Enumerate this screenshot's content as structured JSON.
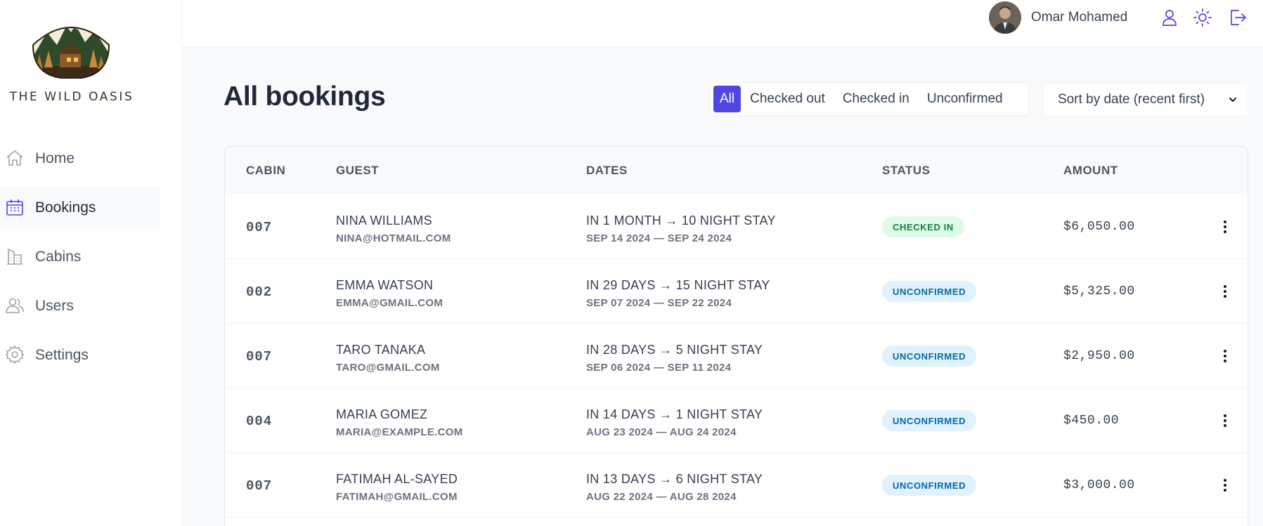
{
  "brand": {
    "name": "THE WILD OASIS"
  },
  "nav": [
    {
      "label": "Home",
      "icon": "home-icon",
      "active": false
    },
    {
      "label": "Bookings",
      "icon": "calendar-icon",
      "active": true
    },
    {
      "label": "Cabins",
      "icon": "building-icon",
      "active": false
    },
    {
      "label": "Users",
      "icon": "users-icon",
      "active": false
    },
    {
      "label": "Settings",
      "icon": "gear-icon",
      "active": false
    }
  ],
  "header": {
    "user_name": "Omar Mohamed",
    "icons": [
      "user-icon",
      "sun-icon",
      "logout-icon"
    ]
  },
  "page": {
    "title": "All bookings"
  },
  "filter": {
    "options": [
      "All",
      "Checked out",
      "Checked in",
      "Unconfirmed"
    ],
    "active": "All"
  },
  "sort": {
    "selected": "Sort by date (recent first)"
  },
  "table": {
    "headers": [
      "CABIN",
      "GUEST",
      "DATES",
      "STATUS",
      "AMOUNT"
    ],
    "rows": [
      {
        "cabin": "007",
        "guest": "NINA WILLIAMS",
        "email": "NINA@HOTMAIL.COM",
        "when": "IN 1 MONTH → 10 NIGHT STAY",
        "range": "SEP 14 2024 — SEP 24 2024",
        "status": "CHECKED IN",
        "status_type": "checked-in",
        "amount": "$6,050.00"
      },
      {
        "cabin": "002",
        "guest": "EMMA WATSON",
        "email": "EMMA@GMAIL.COM",
        "when": "IN 29 DAYS → 15 NIGHT STAY",
        "range": "SEP 07 2024 — SEP 22 2024",
        "status": "UNCONFIRMED",
        "status_type": "unconfirmed",
        "amount": "$5,325.00"
      },
      {
        "cabin": "007",
        "guest": "TARO TANAKA",
        "email": "TARO@GMAIL.COM",
        "when": "IN 28 DAYS → 5 NIGHT STAY",
        "range": "SEP 06 2024 — SEP 11 2024",
        "status": "UNCONFIRMED",
        "status_type": "unconfirmed",
        "amount": "$2,950.00"
      },
      {
        "cabin": "004",
        "guest": "MARIA GOMEZ",
        "email": "MARIA@EXAMPLE.COM",
        "when": "IN 14 DAYS → 1 NIGHT STAY",
        "range": "AUG 23 2024 — AUG 24 2024",
        "status": "UNCONFIRMED",
        "status_type": "unconfirmed",
        "amount": "$450.00"
      },
      {
        "cabin": "007",
        "guest": "FATIMAH AL-SAYED",
        "email": "FATIMAH@GMAIL.COM",
        "when": "IN 13 DAYS → 6 NIGHT STAY",
        "range": "AUG 22 2024 — AUG 28 2024",
        "status": "UNCONFIRMED",
        "status_type": "unconfirmed",
        "amount": "$3,000.00"
      }
    ]
  },
  "colors": {
    "accent": "#4f46e5",
    "checked_in_bg": "#dcfce7",
    "checked_in_fg": "#15803d",
    "unconfirmed_bg": "#e0f2fe",
    "unconfirmed_fg": "#0369a1"
  }
}
